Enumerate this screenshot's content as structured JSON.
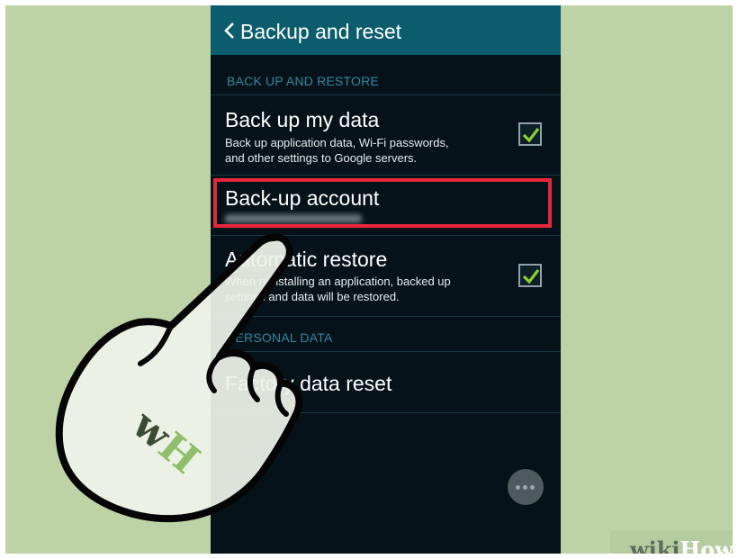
{
  "appbar": {
    "back_icon": "chevron-left-icon",
    "title": "Backup and reset"
  },
  "sections": {
    "backup": "BACK UP AND RESTORE",
    "personal": "PERSONAL DATA"
  },
  "rows": {
    "backup_data": {
      "title": "Back up my data",
      "subtitle_line1": "Back up application data, Wi-Fi passwords,",
      "subtitle_line2": "and other settings to Google servers.",
      "checked": true
    },
    "backup_account": {
      "title": "Back-up account",
      "value_obscured": true
    },
    "auto_restore": {
      "title_visible": "Auto",
      "title_rest": "matic restore",
      "subtitle_line1": "When reinstalling an application, backed up",
      "subtitle_line2": "settings and data will be restored.",
      "checked": true
    },
    "factory_reset": {
      "title": "Factory data reset"
    }
  },
  "overlay": {
    "hand_icon": "pointing-hand-icon",
    "logo_text": "wH",
    "watermark_wiki": "wiki",
    "watermark_how": "How"
  },
  "colors": {
    "background": "#bdd3a6",
    "appbar": "#0b5d6e",
    "screen": "#06121a",
    "highlight": "#e5273d",
    "check": "#8ad12f"
  }
}
